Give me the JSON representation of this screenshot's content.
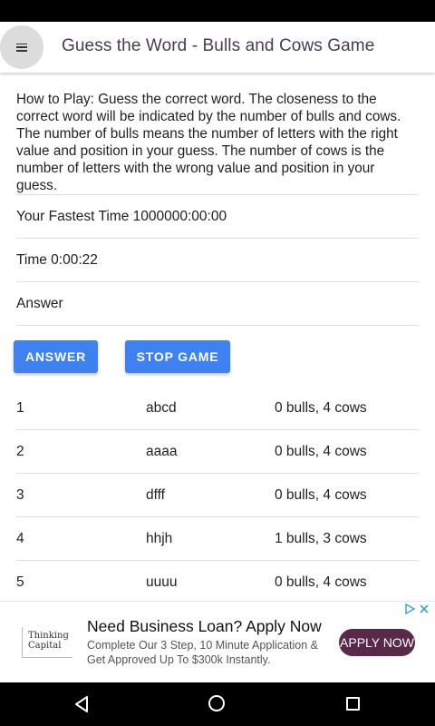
{
  "app_bar": {
    "title": "Guess the Word - Bulls and Cows Game",
    "menu_icon": "hamburger-menu-icon"
  },
  "how_to_play": "How to Play: Guess the correct word. The closeness to the correct word will be indicated by the number of bulls and cows. The number of bulls means the number of letters with the right value and position in your guess. The number of cows is the number of letters with the wrong value and position in your guess.",
  "fastest_time": "Your Fastest Time 1000000:00:00",
  "timer": "Time 0:00:22",
  "answer_placeholder": "Answer",
  "buttons": {
    "answer": "ANSWER",
    "stop": "STOP GAME"
  },
  "history": [
    {
      "n": "1",
      "guess": "abcd",
      "result": "0 bulls, 4 cows"
    },
    {
      "n": "2",
      "guess": "aaaa",
      "result": "0 bulls, 4 cows"
    },
    {
      "n": "3",
      "guess": "dfff",
      "result": "0 bulls, 4 cows"
    },
    {
      "n": "4",
      "guess": "hhjh",
      "result": "1 bulls, 3 cows"
    },
    {
      "n": "5",
      "guess": "uuuu",
      "result": "0 bulls, 4 cows"
    }
  ],
  "ad": {
    "logo_text": "Thinking Capital",
    "headline": "Need Business Loan? Apply Now",
    "body": "Complete Our 3 Step, 10 Minute Application & Get Approved Up To $300k Instantly.",
    "cta": "APPLY NOW",
    "accent": "#5a2848"
  },
  "colors": {
    "button": "#3d82f0",
    "title": "#4a3b52"
  }
}
